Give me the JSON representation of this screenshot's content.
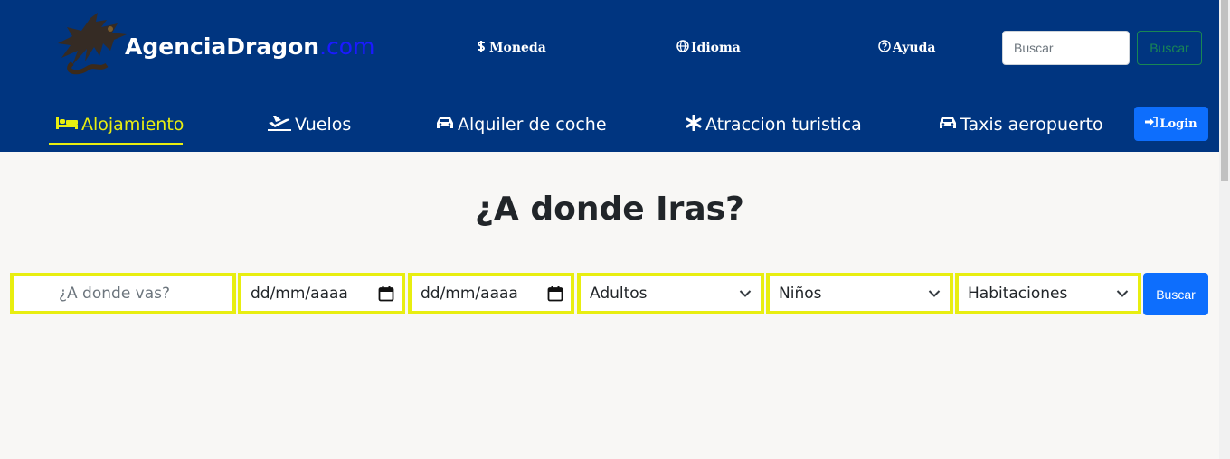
{
  "brand": {
    "name": "AgenciaDragon",
    "tld": ".com"
  },
  "top_links": [
    {
      "label": "Moneda",
      "icon": "dollar-icon"
    },
    {
      "label": "Idioma",
      "icon": "globe-icon"
    },
    {
      "label": "Ayuda",
      "icon": "question-circle-icon"
    }
  ],
  "search": {
    "placeholder": "Buscar",
    "button_label": "Buscar"
  },
  "nav": [
    {
      "label": "Alojamiento",
      "icon": "bed-icon",
      "active": true
    },
    {
      "label": "Vuelos",
      "icon": "plane-icon"
    },
    {
      "label": "Alquiler de coche",
      "icon": "car-icon"
    },
    {
      "label": "Atraccion turistica",
      "icon": "asterisk-icon"
    },
    {
      "label": "Taxis aeropuerto",
      "icon": "taxi-icon"
    }
  ],
  "login": {
    "label": "Login",
    "icon": "sign-in-icon"
  },
  "headline": "¿A donde Iras?",
  "booking": {
    "destination_placeholder": "¿A donde vas?",
    "checkin": "dd/mm/aaaa",
    "checkout": "dd/mm/aaaa",
    "adults": "Adultos",
    "children": "Niños",
    "rooms": "Habitaciones",
    "submit_label": "Buscar"
  },
  "colors": {
    "navbar": "#003580",
    "accent_yellow": "#e8ee10",
    "primary_button": "#0d6efd",
    "success_outline": "#198754",
    "page_background": "#f8f7f5"
  }
}
